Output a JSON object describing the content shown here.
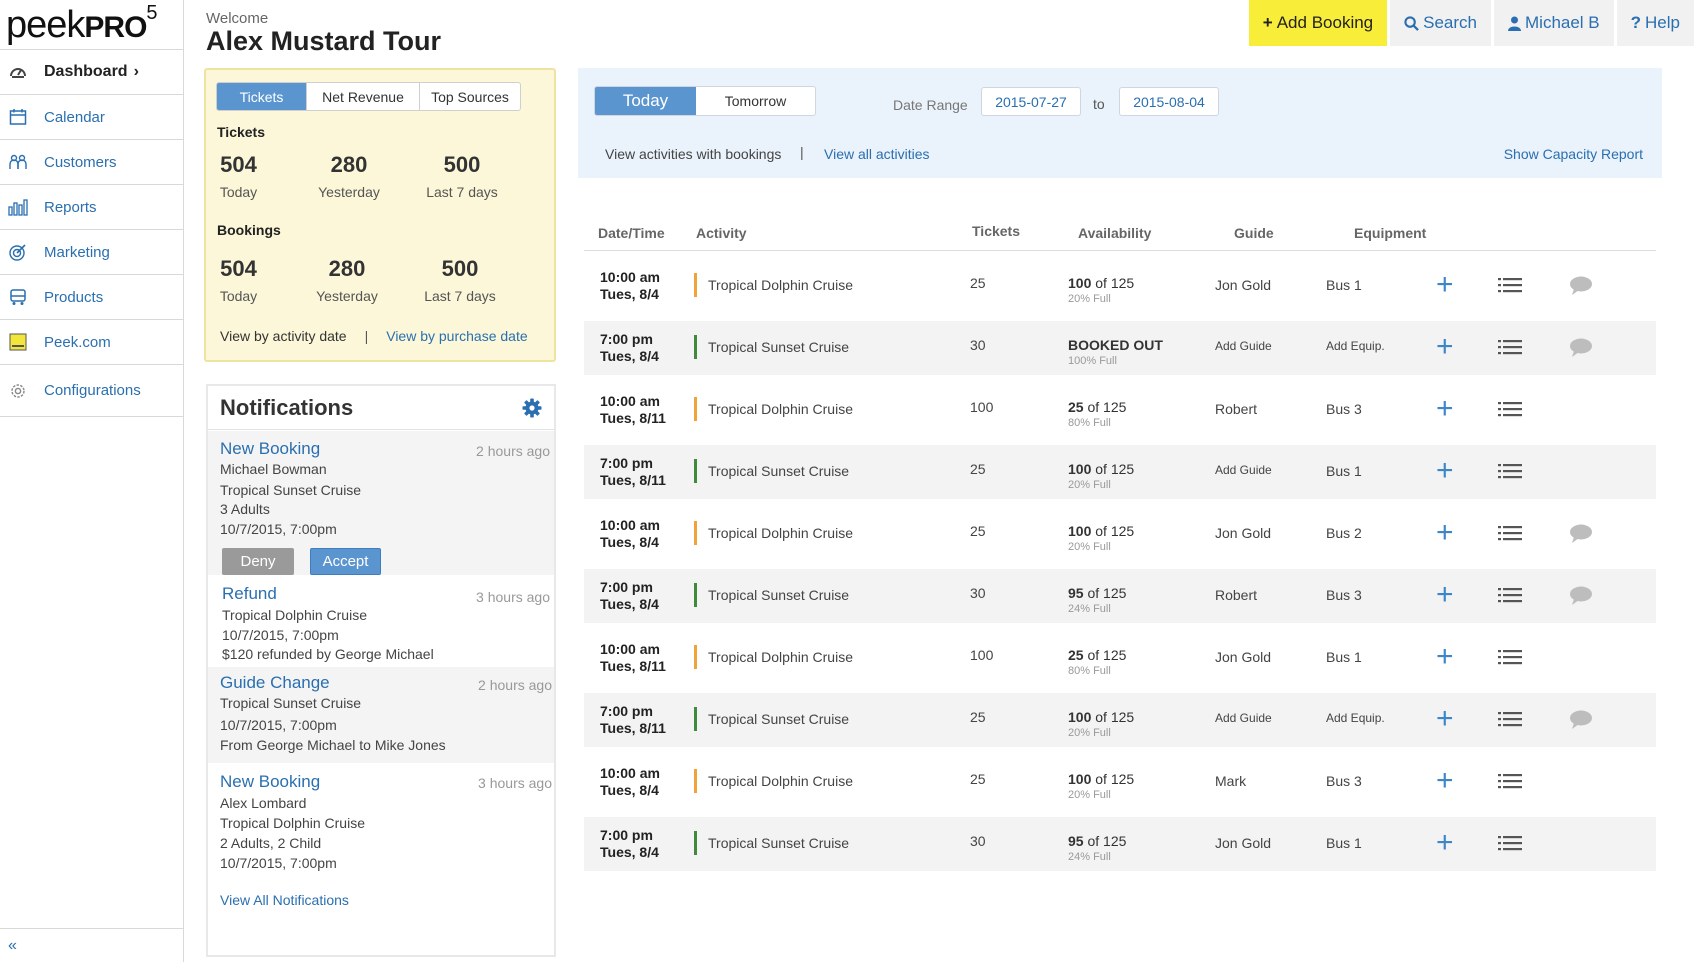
{
  "app": {
    "logo_main": "peek",
    "logo_pro": "PRO",
    "logo_version": "5"
  },
  "sidebar": {
    "items": [
      {
        "label": "Dashboard",
        "suffix": "›",
        "icon": "dashboard-gauge-icon"
      },
      {
        "label": "Calendar",
        "icon": "calendar-icon"
      },
      {
        "label": "Customers",
        "icon": "customers-icon"
      },
      {
        "label": "Reports",
        "icon": "reports-icon"
      },
      {
        "label": "Marketing",
        "icon": "marketing-icon"
      },
      {
        "label": "Products",
        "icon": "products-icon"
      },
      {
        "label": "Peek.com",
        "icon": "peek-com-icon"
      },
      {
        "label": "Configurations",
        "icon": "gear-icon"
      }
    ],
    "collapse": "«"
  },
  "header": {
    "welcome": "Welcome",
    "title": "Alex Mustard Tour"
  },
  "topbar": {
    "add_booking": "Add Booking",
    "search": "Search",
    "user": "Michael B",
    "help": "Help",
    "add_icon": "+",
    "help_icon": "?"
  },
  "stats": {
    "tabs": [
      "Tickets",
      "Net Revenue",
      "Top Sources"
    ],
    "tickets_label": "Tickets",
    "tickets": [
      {
        "value": "504",
        "label": "Today"
      },
      {
        "value": "280",
        "label": "Yesterday"
      },
      {
        "value": "500",
        "label": "Last 7 days"
      }
    ],
    "bookings_label": "Bookings",
    "bookings": [
      {
        "value": "504",
        "label": "Today"
      },
      {
        "value": "280",
        "label": "Yesterday"
      },
      {
        "value": "500",
        "label": "Last 7 days"
      }
    ],
    "view_activity": "View by activity date",
    "separator": "|",
    "view_purchase": "View by purchase date"
  },
  "notifications": {
    "title": "Notifications",
    "items": [
      {
        "title": "New Booking",
        "time": "2 hours ago",
        "lines": [
          "Michael Bowman",
          "Tropical Sunset Cruise",
          "3 Adults",
          "10/7/2015, 7:00pm"
        ],
        "deny": "Deny",
        "accept": "Accept"
      },
      {
        "title": "Refund",
        "time": "3 hours ago",
        "lines": [
          "Tropical Dolphin Cruise",
          "10/7/2015, 7:00pm",
          "$120 refunded by George Michael"
        ]
      },
      {
        "title": "Guide Change",
        "time": "2 hours ago",
        "lines": [
          "Tropical Sunset Cruise",
          "10/7/2015, 7:00pm",
          "From George Michael to Mike Jones"
        ]
      },
      {
        "title": "New Booking",
        "time": "3 hours ago",
        "lines": [
          "Alex Lombard",
          "Tropical Dolphin Cruise",
          "2 Adults, 2 Child",
          "10/7/2015, 7:00pm"
        ]
      }
    ],
    "view_all": "View All Notifications"
  },
  "filter": {
    "tabs": [
      "Today",
      "Tomorrow"
    ],
    "date_range_label": "Date Range",
    "from": "2015-07-27",
    "to_label": "to",
    "to": "2015-08-04",
    "view_with": "View activities with bookings",
    "separator": "|",
    "view_all": "View all activities",
    "capacity": "Show Capacity Report"
  },
  "table": {
    "headers": {
      "datetime": "Date/Time",
      "activity": "Activity",
      "tickets": "Tickets",
      "availability": "Availability",
      "guide": "Guide",
      "equipment": "Equipment"
    },
    "colors": {
      "dolphin": "#f0a33a",
      "sunset": "#3f8a3b"
    },
    "rows": [
      {
        "time": "10:00 am",
        "date": "Tues, 8/4",
        "type": "dolphin",
        "activity": "Tropical Dolphin Cruise",
        "tickets": "25",
        "avail_bold": "100",
        "avail_rest": " of 125",
        "pct": "20% Full",
        "guide": "Jon Gold",
        "equip": "Bus 1",
        "comment": true,
        "shade": false
      },
      {
        "time": "7:00 pm",
        "date": "Tues, 8/4",
        "type": "sunset",
        "activity": "Tropical Sunset Cruise",
        "tickets": "30",
        "avail_bold": "BOOKED OUT",
        "avail_rest": "",
        "pct": "100% Full",
        "guide": "Add Guide",
        "equip": "Add Equip.",
        "comment": true,
        "shade": true
      },
      {
        "time": "10:00 am",
        "date": "Tues, 8/11",
        "type": "dolphin",
        "activity": "Tropical Dolphin Cruise",
        "tickets": "100",
        "avail_bold": "25",
        "avail_rest": " of 125",
        "pct": "80% Full",
        "guide": "Robert",
        "equip": "Bus 3",
        "comment": false,
        "shade": false
      },
      {
        "time": "7:00 pm",
        "date": "Tues, 8/11",
        "type": "sunset",
        "activity": "Tropical Sunset Cruise",
        "tickets": "25",
        "avail_bold": "100",
        "avail_rest": " of 125",
        "pct": "20% Full",
        "guide": "Add Guide",
        "equip": "Bus 1",
        "comment": false,
        "shade": true
      },
      {
        "time": "10:00 am",
        "date": "Tues, 8/4",
        "type": "dolphin",
        "activity": "Tropical Dolphin Cruise",
        "tickets": "25",
        "avail_bold": "100",
        "avail_rest": " of 125",
        "pct": "20% Full",
        "guide": "Jon Gold",
        "equip": "Bus 2",
        "comment": true,
        "shade": false
      },
      {
        "time": "7:00 pm",
        "date": "Tues, 8/4",
        "type": "sunset",
        "activity": "Tropical Sunset Cruise",
        "tickets": "30",
        "avail_bold": "95",
        "avail_rest": " of 125",
        "pct": "24% Full",
        "guide": "Robert",
        "equip": "Bus 3",
        "comment": true,
        "shade": true
      },
      {
        "time": "10:00 am",
        "date": "Tues, 8/11",
        "type": "dolphin",
        "activity": "Tropical Dolphin Cruise",
        "tickets": "100",
        "avail_bold": "25",
        "avail_rest": " of 125",
        "pct": "80% Full",
        "guide": "Jon Gold",
        "equip": "Bus 1",
        "comment": false,
        "shade": false
      },
      {
        "time": "7:00 pm",
        "date": "Tues, 8/11",
        "type": "sunset",
        "activity": "Tropical Sunset Cruise",
        "tickets": "25",
        "avail_bold": "100",
        "avail_rest": " of 125",
        "pct": "20% Full",
        "guide": "Add Guide",
        "equip": "Add Equip.",
        "comment": true,
        "shade": true
      },
      {
        "time": "10:00 am",
        "date": "Tues, 8/4",
        "type": "dolphin",
        "activity": "Tropical Dolphin Cruise",
        "tickets": "25",
        "avail_bold": "100",
        "avail_rest": " of 125",
        "pct": "20% Full",
        "guide": "Mark",
        "equip": "Bus 3",
        "comment": false,
        "shade": false
      },
      {
        "time": "7:00 pm",
        "date": "Tues, 8/4",
        "type": "sunset",
        "activity": "Tropical Sunset Cruise",
        "tickets": "30",
        "avail_bold": "95",
        "avail_rest": " of 125",
        "pct": "24% Full",
        "guide": "Jon Gold",
        "equip": "Bus 1",
        "comment": false,
        "shade": true
      }
    ]
  }
}
